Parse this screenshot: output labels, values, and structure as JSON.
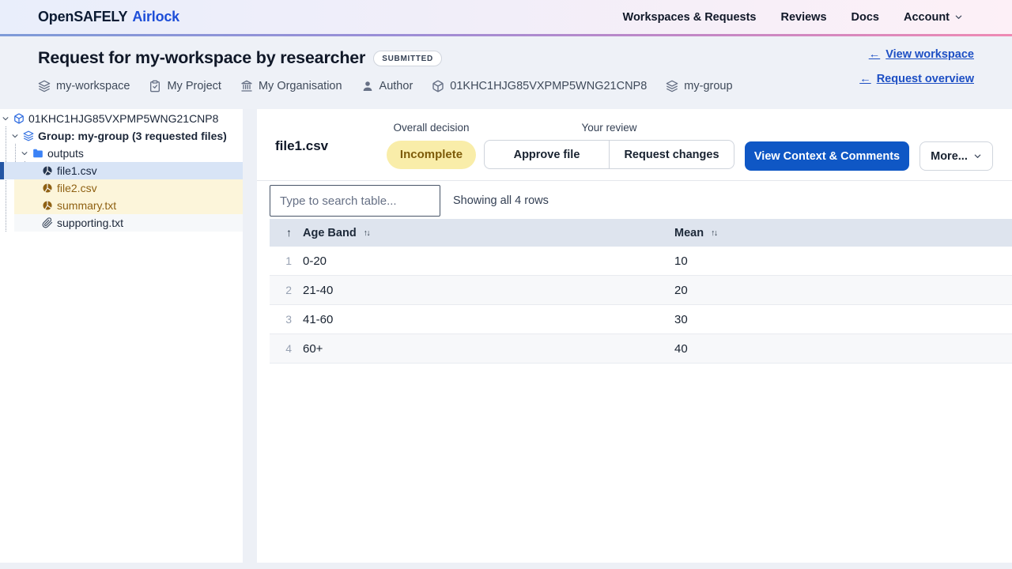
{
  "colors": {
    "primary_button": "#0f57c5",
    "link_blue": "#1d4fc4",
    "selected_row_bg": "#d8e4f6",
    "selected_bar": "#2456a4",
    "attention_row_bg": "#fcf5da",
    "attention_text": "#8f6113",
    "incomplete_badge_bg": "#f9eda9",
    "incomplete_badge_text": "#7d5b09",
    "table_header_bg": "#dee4ee",
    "nav_gradient_left": "#e9eefb",
    "nav_gradient_right": "#fdf0f7"
  },
  "nav": {
    "brand_primary": "OpenSAFELY",
    "brand_secondary": "Airlock",
    "items": [
      {
        "label": "Workspaces & Requests"
      },
      {
        "label": "Reviews"
      },
      {
        "label": "Docs"
      }
    ],
    "account_label": "Account"
  },
  "header": {
    "title": "Request for my-workspace by researcher",
    "status_badge": "SUBMITTED",
    "link_arrow": "←",
    "workspace_link": "View workspace",
    "overview_link": "Request overview",
    "meta": [
      {
        "icon": "layers-icon",
        "label": "my-workspace"
      },
      {
        "icon": "clipboard-icon",
        "label": "My Project"
      },
      {
        "icon": "bank-icon",
        "label": "My Organisation"
      },
      {
        "icon": "user-icon",
        "label": "Author"
      },
      {
        "icon": "cube-icon",
        "label": "01KHC1HJG85VXPMP5WNG21CNP8"
      },
      {
        "icon": "layers-icon",
        "label": "my-group"
      }
    ]
  },
  "tree": {
    "nodes": [
      {
        "label": "01KHC1HJG85VXPMP5WNG21CNP8",
        "icon": "cube-icon",
        "expanded": true
      },
      {
        "label": "Group: my-group (3 requested files)",
        "icon": "layers-icon",
        "expanded": true
      },
      {
        "label": "outputs",
        "icon": "folder-icon",
        "expanded": true
      },
      {
        "label": "file1.csv",
        "icon": "chart-file-icon",
        "state": "selected"
      },
      {
        "label": "file2.csv",
        "icon": "chart-file-icon",
        "state": "attention"
      },
      {
        "label": "summary.txt",
        "icon": "chart-file-icon",
        "state": "attention"
      },
      {
        "label": "supporting.txt",
        "icon": "paperclip-icon",
        "state": "supporting"
      }
    ]
  },
  "file_panel": {
    "title": "file1.csv",
    "overall_decision_label": "Overall decision",
    "decision_value": "Incomplete",
    "your_review_label": "Your review",
    "approve_button": "Approve file",
    "request_changes_button": "Request changes",
    "context_button": "View Context & Comments",
    "more_button": "More...",
    "search_placeholder": "Type to search table...",
    "rows_summary": "Showing all 4 rows"
  },
  "table": {
    "columns": [
      "Age Band",
      "Mean"
    ],
    "rows": [
      {
        "index": "1",
        "age_band": "0-20",
        "mean": "10"
      },
      {
        "index": "2",
        "age_band": "21-40",
        "mean": "20"
      },
      {
        "index": "3",
        "age_band": "41-60",
        "mean": "30"
      },
      {
        "index": "4",
        "age_band": "60+",
        "mean": "40"
      }
    ]
  }
}
